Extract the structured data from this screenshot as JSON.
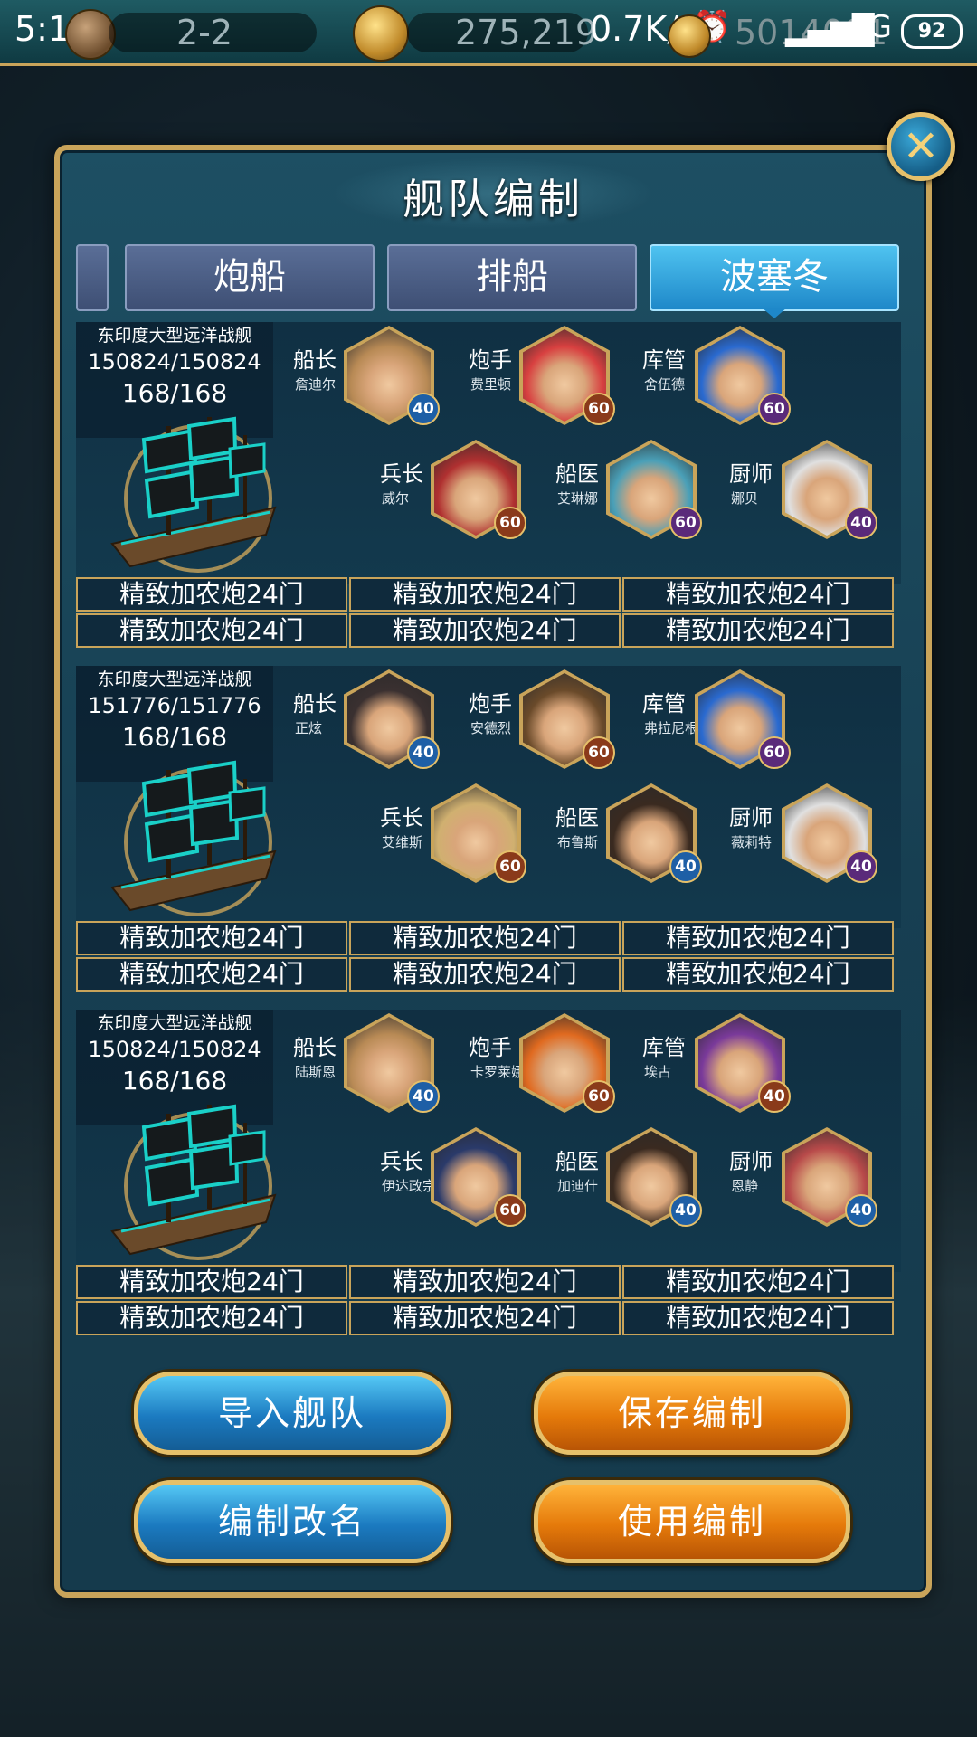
{
  "status_bar": {
    "time": "5:18",
    "net_speed": "0.7K/s",
    "signal": "4G",
    "battery": "92"
  },
  "resources": {
    "stage": "2-2",
    "amount_1": "275,219",
    "amount_2": "5014091"
  },
  "panel": {
    "title": "舰队编制"
  },
  "tabs": [
    {
      "label": ""
    },
    {
      "label": "炮船"
    },
    {
      "label": "排船"
    },
    {
      "label": "波塞冬"
    }
  ],
  "fleet": [
    {
      "ship_name": "东印度大型远洋战舰",
      "hp": "150824/150824",
      "crew": "168/168",
      "officers": [
        {
          "role": "船长",
          "name": "詹迪尔",
          "level": "40",
          "badge": "b",
          "color": "#b88a55"
        },
        {
          "role": "炮手",
          "name": "费里顿",
          "level": "60",
          "badge": "r",
          "color": "#d84040"
        },
        {
          "role": "库管",
          "name": "舍伍德",
          "level": "60",
          "badge": "p",
          "color": "#2a6ad0"
        },
        {
          "role": "兵长",
          "name": "威尔",
          "level": "60",
          "badge": "r",
          "color": "#b03030"
        },
        {
          "role": "船医",
          "name": "艾琳娜",
          "level": "60",
          "badge": "p",
          "color": "#4aa0b8"
        },
        {
          "role": "厨师",
          "name": "娜贝",
          "level": "40",
          "badge": "p",
          "color": "#e0e0e0"
        }
      ],
      "cannons": [
        "精致加农炮24门",
        "精致加农炮24门",
        "精致加农炮24门",
        "精致加农炮24门",
        "精致加农炮24门",
        "精致加农炮24门"
      ]
    },
    {
      "ship_name": "东印度大型远洋战舰",
      "hp": "151776/151776",
      "crew": "168/168",
      "officers": [
        {
          "role": "船长",
          "name": "正炫",
          "level": "40",
          "badge": "b",
          "color": "#3a3030"
        },
        {
          "role": "炮手",
          "name": "安德烈",
          "level": "60",
          "badge": "r",
          "color": "#6a4a2a"
        },
        {
          "role": "库管",
          "name": "弗拉尼根",
          "level": "60",
          "badge": "p",
          "color": "#2a6ad0"
        },
        {
          "role": "兵长",
          "name": "艾维斯",
          "level": "60",
          "badge": "r",
          "color": "#d0b070"
        },
        {
          "role": "船医",
          "name": "布鲁斯",
          "level": "40",
          "badge": "b",
          "color": "#3a2a20"
        },
        {
          "role": "厨师",
          "name": "薇莉特",
          "level": "40",
          "badge": "p",
          "color": "#e0e0e0"
        }
      ],
      "cannons": [
        "精致加农炮24门",
        "精致加农炮24门",
        "精致加农炮24门",
        "精致加农炮24门",
        "精致加农炮24门",
        "精致加农炮24门"
      ]
    },
    {
      "ship_name": "东印度大型远洋战舰",
      "hp": "150824/150824",
      "crew": "168/168",
      "officers": [
        {
          "role": "船长",
          "name": "陆斯恩",
          "level": "40",
          "badge": "b",
          "color": "#b88a55"
        },
        {
          "role": "炮手",
          "name": "卡罗莱娜",
          "level": "60",
          "badge": "r",
          "color": "#e06a20"
        },
        {
          "role": "库管",
          "name": "埃古",
          "level": "40",
          "badge": "r",
          "color": "#7a3a9a"
        },
        {
          "role": "兵长",
          "name": "伊达政宗",
          "level": "60",
          "badge": "r",
          "color": "#2a3a6a"
        },
        {
          "role": "船医",
          "name": "加迪什",
          "level": "40",
          "badge": "b",
          "color": "#3a2a20"
        },
        {
          "role": "厨师",
          "name": "恩静",
          "level": "40",
          "badge": "b",
          "color": "#b84a4a"
        }
      ],
      "cannons": [
        "精致加农炮24门",
        "精致加农炮24门",
        "精致加农炮24门",
        "精致加农炮24门",
        "精致加农炮24门",
        "精致加农炮24门"
      ]
    }
  ],
  "buttons": {
    "import": "导入舰队",
    "save": "保存编制",
    "rename": "编制改名",
    "use": "使用编制"
  }
}
